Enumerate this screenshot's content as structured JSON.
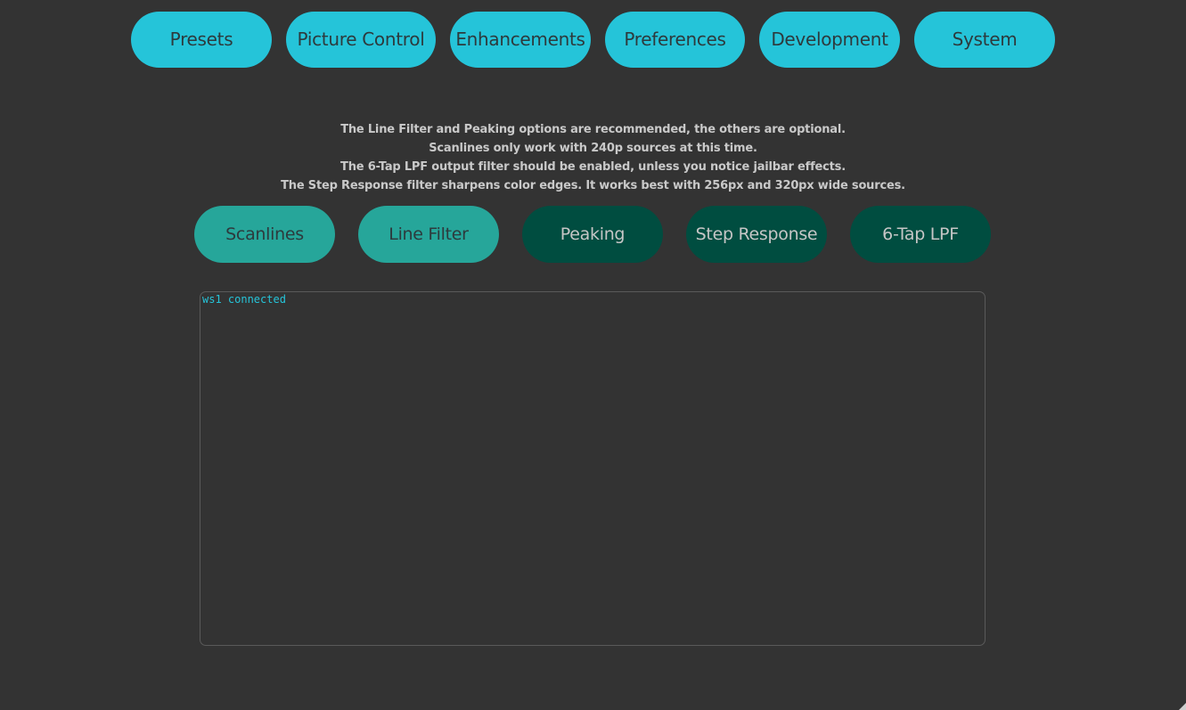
{
  "nav": {
    "items": [
      {
        "label": "Presets"
      },
      {
        "label": "Picture Control"
      },
      {
        "label": "Enhancements"
      },
      {
        "label": "Preferences"
      },
      {
        "label": "Development"
      },
      {
        "label": "System"
      }
    ],
    "active_color": "#25c4d9"
  },
  "info": {
    "lines": [
      "The Line Filter and Peaking options are recommended, the others are optional.",
      "Scanlines only work with 240p sources at this time.",
      "The 6-Tap LPF output filter should be enabled, unless you notice jailbar effects.",
      "The Step Response filter sharpens color edges. It works best with 256px and 320px wide sources."
    ]
  },
  "toggles": {
    "items": [
      {
        "label": "Scanlines",
        "state": "on"
      },
      {
        "label": "Line Filter",
        "state": "on"
      },
      {
        "label": "Peaking",
        "state": "off"
      },
      {
        "label": "Step Response",
        "state": "off"
      },
      {
        "label": "6-Tap LPF",
        "state": "off"
      }
    ],
    "on_color": "#26a69a",
    "off_color": "#004d40"
  },
  "log": {
    "text": "ws1 connected"
  }
}
